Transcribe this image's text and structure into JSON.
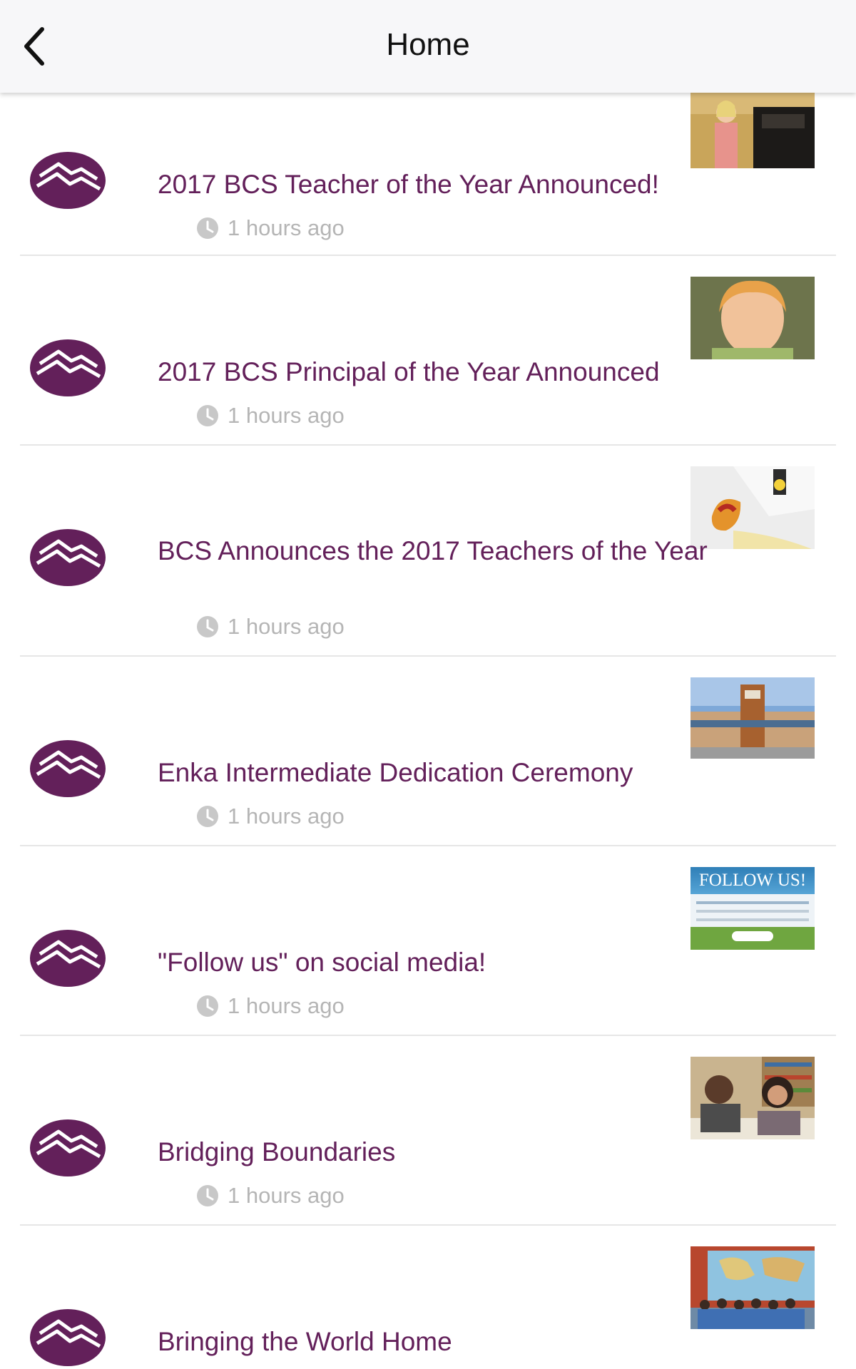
{
  "header": {
    "title": "Home"
  },
  "colors": {
    "brand_purple": "#63205a",
    "meta_gray": "#b5b5b5",
    "header_bg": "#f7f7f9"
  },
  "icons": {
    "back": "chevron-left-icon",
    "time": "clock-icon",
    "logo": "mountain-logo-icon"
  },
  "feed": {
    "items": [
      {
        "title": "2017 BCS Teacher of the Year Announced!",
        "meta": "1 hours ago"
      },
      {
        "title": "2017 BCS Principal of the Year Announced",
        "meta": "1 hours ago"
      },
      {
        "title": "BCS Announces the 2017 Teachers of the Year",
        "meta": "1 hours ago"
      },
      {
        "title": "Enka Intermediate Dedication Ceremony",
        "meta": "1 hours ago"
      },
      {
        "title": "\"Follow us\" on social media!",
        "meta": "1 hours ago"
      },
      {
        "title": "Bridging Boundaries",
        "meta": "1 hours ago"
      },
      {
        "title": "Bringing the World Home",
        "meta": ""
      }
    ],
    "thumb_5_text": "FOLLOW US!"
  }
}
